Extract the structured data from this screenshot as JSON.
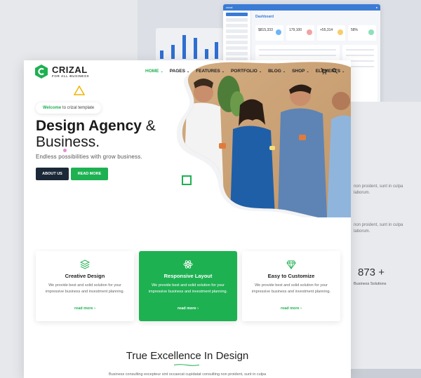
{
  "dashboard": {
    "title": "Dashboard",
    "stats": [
      "$815,333",
      "179,100",
      "+55,314",
      "58%"
    ]
  },
  "background": {
    "right_text_1": "non proident, sunt in culpa\nlaborum.",
    "right_text_2": "non proident, sunt in culpa\nlaborum.",
    "stat_number": "873 +",
    "stat_label": "Business Solutions"
  },
  "brand": {
    "name": "CRIZAL",
    "tagline": "FOR ALL BUSINESS",
    "accent": "#1eb152",
    "dark": "#1b2838"
  },
  "nav": {
    "items": [
      "HOME",
      "PAGES",
      "FEATURES",
      "PORTFOLIO",
      "BLOG",
      "SHOP",
      "ELEMENTS"
    ],
    "active": "HOME",
    "icons": [
      "cart-icon",
      "search-icon"
    ]
  },
  "hero": {
    "welcome_highlight": "Welcome",
    "welcome_rest": " to crizal template",
    "title_bold": "Design Agency",
    "title_amp": " &",
    "title_line2": "Business.",
    "subtitle": "Endless possibilities with grow business.",
    "about_button": "ABOUT US",
    "read_button": "READ MORE"
  },
  "features": [
    {
      "title": "Creative Design",
      "desc": "We provide best and solid solution for your impressive business and investment planning.",
      "link": "read more ›",
      "icon": "layers-icon",
      "highlighted": false
    },
    {
      "title": "Responsive Layout",
      "desc": "We provide best and solid solution for your impressive business and investment planning.",
      "link": "read more ›",
      "icon": "atom-icon",
      "highlighted": true
    },
    {
      "title": "Easy to Customize",
      "desc": "We provide best and solid solution for your impressive business and investment planning.",
      "link": "read more ›",
      "icon": "diamond-icon",
      "highlighted": false
    }
  ],
  "section": {
    "title": "True Excellence In Design",
    "text": "Business consulting excepteur sint occaecat cupidatat consulting non proident, sunt in culpa"
  }
}
